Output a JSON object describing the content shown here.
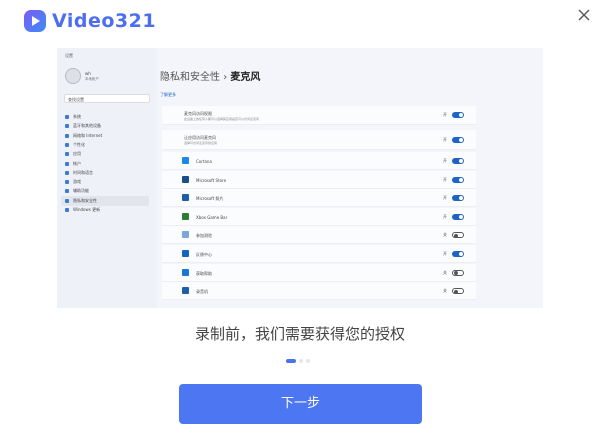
{
  "app": {
    "name": "Video321",
    "brand_color": "#4d76f2"
  },
  "settings": {
    "window_title": "设置",
    "user": {
      "name": "wh",
      "type": "本地帐户"
    },
    "search_placeholder": "查找设置",
    "nav": [
      "系统",
      "蓝牙和其他设备",
      "网络和 Internet",
      "个性化",
      "应用",
      "帐户",
      "时间和语言",
      "游戏",
      "辅助功能",
      "隐私和安全性",
      "Windows 更新"
    ],
    "breadcrumb_parent": "隐私和安全性",
    "breadcrumb_sep": "›",
    "page_title": "麦克风",
    "learn_more": "了解更多",
    "mic_access": {
      "label": "麦克风访问权限",
      "sub": "此设备上的任何人都可以选择其应用是否可以访问麦克风",
      "state": "开"
    },
    "apps_access": {
      "label": "让应用访问麦克风",
      "sub": "选择可访问麦克风的应用",
      "state": "开"
    },
    "apps": [
      {
        "name": "Cortana",
        "state": "开",
        "on": true,
        "color": "#1e88e5"
      },
      {
        "name": "Microsoft Store",
        "state": "开",
        "on": true,
        "color": "#1b4f8a"
      },
      {
        "name": "Microsoft 照片",
        "state": "开",
        "on": true,
        "color": "#1a5fa8"
      },
      {
        "name": "Xbox Game Bar",
        "state": "开",
        "on": true,
        "color": "#2e7d32"
      },
      {
        "name": "参加测验",
        "state": "关",
        "on": false,
        "color": "#7fa6d8"
      },
      {
        "name": "反馈中心",
        "state": "开",
        "on": true,
        "color": "#1565c0"
      },
      {
        "name": "获取帮助",
        "state": "关",
        "on": false,
        "color": "#1976d2"
      },
      {
        "name": "录音机",
        "state": "关",
        "on": false,
        "color": "#1e5fa8"
      }
    ]
  },
  "caption": "录制前，我们需要获得您的授权",
  "pager": {
    "total": 3,
    "current": 1
  },
  "next_label": "下一步"
}
